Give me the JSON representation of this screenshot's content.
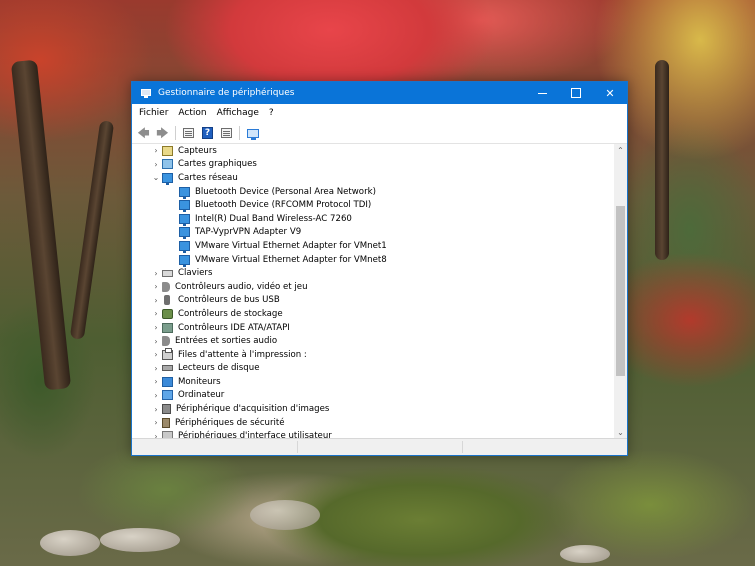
{
  "window": {
    "title": "Gestionnaire de périphériques",
    "controls": {
      "minimize_icon": "minimize-icon",
      "maximize_icon": "maximize-icon",
      "close_icon": "close-icon"
    }
  },
  "menu": [
    "Fichier",
    "Action",
    "Affichage",
    "?"
  ],
  "toolbar": [
    "back-arrow-icon",
    "forward-arrow-icon",
    "properties-icon",
    "help-icon",
    "console-tree-icon",
    "scan-hardware-icon"
  ],
  "tree": [
    {
      "label": "Capteurs",
      "icon": "sensor-icon",
      "expanded": false
    },
    {
      "label": "Cartes graphiques",
      "icon": "display-adapter-icon",
      "expanded": false
    },
    {
      "label": "Cartes réseau",
      "icon": "network-adapter-icon",
      "expanded": true
    },
    {
      "label": "Bluetooth Device (Personal Area Network)",
      "icon": "network-adapter-icon",
      "child": true
    },
    {
      "label": "Bluetooth Device (RFCOMM Protocol TDI)",
      "icon": "network-adapter-icon",
      "child": true
    },
    {
      "label": "Intel(R) Dual Band Wireless-AC 7260",
      "icon": "network-adapter-icon",
      "child": true
    },
    {
      "label": "TAP-VyprVPN Adapter V9",
      "icon": "network-adapter-icon",
      "child": true
    },
    {
      "label": "VMware Virtual Ethernet Adapter for VMnet1",
      "icon": "network-adapter-icon",
      "child": true
    },
    {
      "label": "VMware Virtual Ethernet Adapter for VMnet8",
      "icon": "network-adapter-icon",
      "child": true
    },
    {
      "label": "Claviers",
      "icon": "keyboard-icon",
      "expanded": false
    },
    {
      "label": "Contrôleurs audio, vidéo et jeu",
      "icon": "audio-icon",
      "expanded": false
    },
    {
      "label": "Contrôleurs de bus USB",
      "icon": "usb-icon",
      "expanded": false
    },
    {
      "label": "Contrôleurs de stockage",
      "icon": "storage-icon",
      "expanded": false
    },
    {
      "label": "Contrôleurs IDE ATA/ATAPI",
      "icon": "ide-icon",
      "expanded": false
    },
    {
      "label": "Entrées et sorties audio",
      "icon": "audio-icon",
      "expanded": false
    },
    {
      "label": "Files d'attente à l'impression :",
      "icon": "printer-icon",
      "expanded": false
    },
    {
      "label": "Lecteurs de disque",
      "icon": "disk-drive-icon",
      "expanded": false
    },
    {
      "label": "Moniteurs",
      "icon": "monitor-icon",
      "expanded": false
    },
    {
      "label": "Ordinateur",
      "icon": "computer-icon",
      "expanded": false
    },
    {
      "label": "Périphérique d'acquisition d'images",
      "icon": "camera-icon",
      "expanded": false
    },
    {
      "label": "Périphériques de sécurité",
      "icon": "security-device-icon",
      "expanded": false
    },
    {
      "label": "Périphériques d'interface utilisateur",
      "icon": "hid-icon",
      "expanded": false
    }
  ],
  "colors": {
    "titlebar": "#0a74d8",
    "window_border": "#1a73c9"
  }
}
